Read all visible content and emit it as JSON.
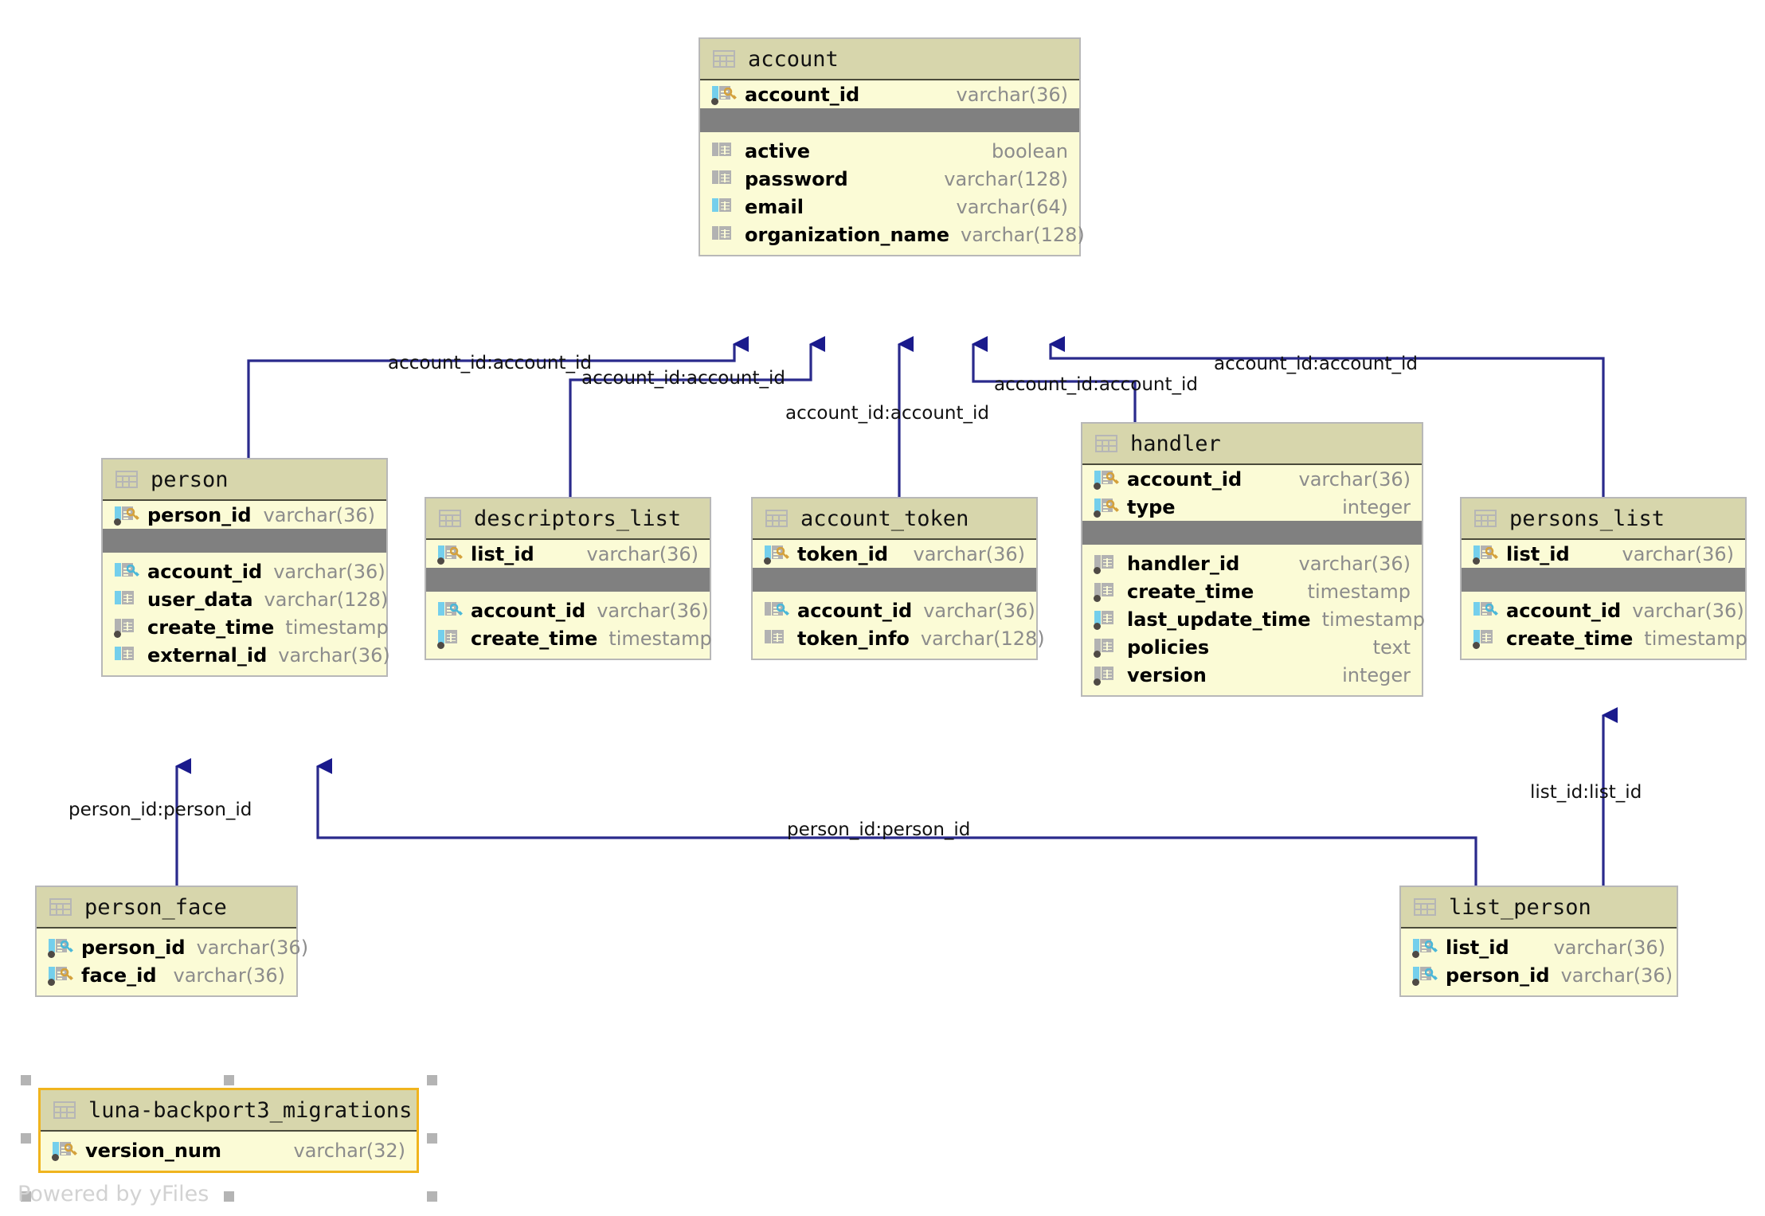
{
  "diagram": {
    "kind": "database-er-diagram",
    "watermark": "Powered by yFiles",
    "colors": {
      "node_fill": "#FBFBD6",
      "node_header_fill": "#D7D6AC",
      "node_border": "#B8B8B8",
      "selected_border": "#F0B41E",
      "separator": "#808080",
      "edge": "#2A2A8C",
      "pk_key": "#D4A13C",
      "fk_key": "#4BB8D8",
      "indexed_bar": "#74CFEC",
      "plain_bar": "#B2B2B2",
      "notnull_dot": "#4F4A45",
      "type_text": "#8C8C8C"
    }
  },
  "tables": {
    "account": {
      "name": "account",
      "keys": [
        {
          "name": "account_id",
          "type": "varchar(36)",
          "key": "pk",
          "indexed": true,
          "notnull": true
        }
      ],
      "columns": [
        {
          "name": "active",
          "type": "boolean",
          "key": "none",
          "indexed": false,
          "notnull": false
        },
        {
          "name": "password",
          "type": "varchar(128)",
          "key": "none",
          "indexed": false,
          "notnull": false
        },
        {
          "name": "email",
          "type": "varchar(64)",
          "key": "none",
          "indexed": true,
          "notnull": false
        },
        {
          "name": "organization_name",
          "type": "varchar(128)",
          "key": "none",
          "indexed": false,
          "notnull": false
        }
      ]
    },
    "person": {
      "name": "person",
      "keys": [
        {
          "name": "person_id",
          "type": "varchar(36)",
          "key": "pk",
          "indexed": true,
          "notnull": true
        }
      ],
      "columns": [
        {
          "name": "account_id",
          "type": "varchar(36)",
          "key": "fk",
          "indexed": true,
          "notnull": false
        },
        {
          "name": "user_data",
          "type": "varchar(128)",
          "key": "none",
          "indexed": true,
          "notnull": false
        },
        {
          "name": "create_time",
          "type": "timestamp",
          "key": "none",
          "indexed": false,
          "notnull": true
        },
        {
          "name": "external_id",
          "type": "varchar(36)",
          "key": "none",
          "indexed": true,
          "notnull": false
        }
      ]
    },
    "descriptors_list": {
      "name": "descriptors_list",
      "keys": [
        {
          "name": "list_id",
          "type": "varchar(36)",
          "key": "pk",
          "indexed": true,
          "notnull": true
        }
      ],
      "columns": [
        {
          "name": "account_id",
          "type": "varchar(36)",
          "key": "fk",
          "indexed": true,
          "notnull": false
        },
        {
          "name": "create_time",
          "type": "timestamp",
          "key": "none",
          "indexed": true,
          "notnull": true
        }
      ]
    },
    "account_token": {
      "name": "account_token",
      "keys": [
        {
          "name": "token_id",
          "type": "varchar(36)",
          "key": "pk",
          "indexed": true,
          "notnull": true
        }
      ],
      "columns": [
        {
          "name": "account_id",
          "type": "varchar(36)",
          "key": "fk",
          "indexed": false,
          "notnull": false
        },
        {
          "name": "token_info",
          "type": "varchar(128)",
          "key": "none",
          "indexed": false,
          "notnull": false
        }
      ]
    },
    "handler": {
      "name": "handler",
      "keys": [
        {
          "name": "account_id",
          "type": "varchar(36)",
          "key": "pk",
          "indexed": true,
          "notnull": true
        },
        {
          "name": "type",
          "type": "integer",
          "key": "pk",
          "indexed": true,
          "notnull": true
        }
      ],
      "columns": [
        {
          "name": "handler_id",
          "type": "varchar(36)",
          "key": "none",
          "indexed": false,
          "notnull": true
        },
        {
          "name": "create_time",
          "type": "timestamp",
          "key": "none",
          "indexed": false,
          "notnull": true
        },
        {
          "name": "last_update_time",
          "type": "timestamp",
          "key": "none",
          "indexed": true,
          "notnull": true
        },
        {
          "name": "policies",
          "type": "text",
          "key": "none",
          "indexed": false,
          "notnull": true
        },
        {
          "name": "version",
          "type": "integer",
          "key": "none",
          "indexed": false,
          "notnull": true
        }
      ]
    },
    "persons_list": {
      "name": "persons_list",
      "keys": [
        {
          "name": "list_id",
          "type": "varchar(36)",
          "key": "pk",
          "indexed": true,
          "notnull": true
        }
      ],
      "columns": [
        {
          "name": "account_id",
          "type": "varchar(36)",
          "key": "fk",
          "indexed": true,
          "notnull": false
        },
        {
          "name": "create_time",
          "type": "timestamp",
          "key": "none",
          "indexed": true,
          "notnull": true
        }
      ]
    },
    "person_face": {
      "name": "person_face",
      "keys": [
        {
          "name": "person_id",
          "type": "varchar(36)",
          "key": "fk",
          "indexed": true,
          "notnull": true
        },
        {
          "name": "face_id",
          "type": "varchar(36)",
          "key": "pk",
          "indexed": true,
          "notnull": true
        }
      ],
      "columns": []
    },
    "list_person": {
      "name": "list_person",
      "keys": [
        {
          "name": "list_id",
          "type": "varchar(36)",
          "key": "fk",
          "indexed": true,
          "notnull": true
        },
        {
          "name": "person_id",
          "type": "fk_mixed",
          "type_label": "varchar(36)",
          "key": "fk",
          "indexed": true,
          "notnull": true
        }
      ],
      "columns": []
    },
    "migrations": {
      "name": "luna-backport3_migrations",
      "selected": true,
      "keys": [
        {
          "name": "version_num",
          "type": "varchar(32)",
          "key": "pk",
          "indexed": true,
          "notnull": true
        }
      ],
      "columns": []
    }
  },
  "edge_labels": [
    {
      "id": "person-account",
      "text": "account_id:account_id"
    },
    {
      "id": "descriptors-account",
      "text": "account_id:account_id"
    },
    {
      "id": "token-account",
      "text": "account_id:account_id"
    },
    {
      "id": "handler-account",
      "text": "account_id:account_id"
    },
    {
      "id": "personslist-account",
      "text": "account_id:account_id"
    },
    {
      "id": "personface-person",
      "text": "person_id:person_id"
    },
    {
      "id": "listperson-person",
      "text": "person_id:person_id"
    },
    {
      "id": "listperson-personslist",
      "text": "list_id:list_id"
    }
  ]
}
